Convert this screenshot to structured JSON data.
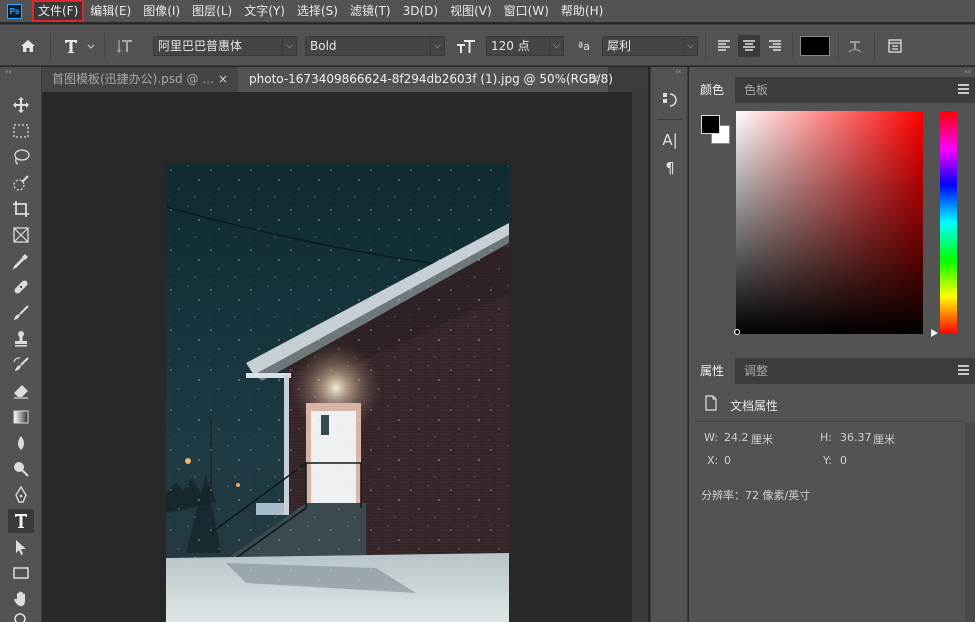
{
  "menu": {
    "logo": "Ps",
    "items": [
      {
        "label": "文件(F)"
      },
      {
        "label": "编辑(E)"
      },
      {
        "label": "图像(I)"
      },
      {
        "label": "图层(L)"
      },
      {
        "label": "文字(Y)"
      },
      {
        "label": "选择(S)"
      },
      {
        "label": "滤镜(T)"
      },
      {
        "label": "3D(D)"
      },
      {
        "label": "视图(V)"
      },
      {
        "label": "窗口(W)"
      },
      {
        "label": "帮助(H)"
      }
    ]
  },
  "options": {
    "font_family": "阿里巴巴普惠体",
    "font_style": "Bold",
    "font_size": "120 点",
    "aa_label": "ªa",
    "antialias": "犀利",
    "color": "#000000"
  },
  "tabs": [
    {
      "label": "首图模板(迅捷办公).psd @ ...",
      "close": "×"
    },
    {
      "label": "photo-1673409866624-8f294db2603f (1).jpg @ 50%(RGB/8)",
      "close": "×"
    }
  ],
  "color_panel": {
    "tabs": [
      "颜色",
      "色板"
    ],
    "foreground": "#000000",
    "background": "#ffffff"
  },
  "properties_panel": {
    "tabs": [
      "属性",
      "调整"
    ],
    "doc_label": "文档属性",
    "w_label": "W:",
    "w_value": "24.2",
    "w_unit": "厘米",
    "h_label": "H:",
    "h_value": "36.37",
    "h_unit": "厘米",
    "x_label": "X:",
    "x_value": "0",
    "y_label": "Y:",
    "y_value": "0",
    "resolution": "分辨率：72 像素/英寸"
  },
  "tool_icons": [
    "move-icon",
    "marquee-icon",
    "lasso-icon",
    "quick-select-icon",
    "crop-icon",
    "frame-icon",
    "eyedropper-icon",
    "healing-icon",
    "brush-icon",
    "stamp-icon",
    "history-brush-icon",
    "eraser-icon",
    "gradient-icon",
    "blur-icon",
    "dodge-icon",
    "pen-icon",
    "type-icon",
    "path-select-icon",
    "rectangle-icon",
    "hand-icon",
    "zoom-icon"
  ],
  "mid_icons": {
    "char_label": "A|",
    "para_label": "¶"
  }
}
